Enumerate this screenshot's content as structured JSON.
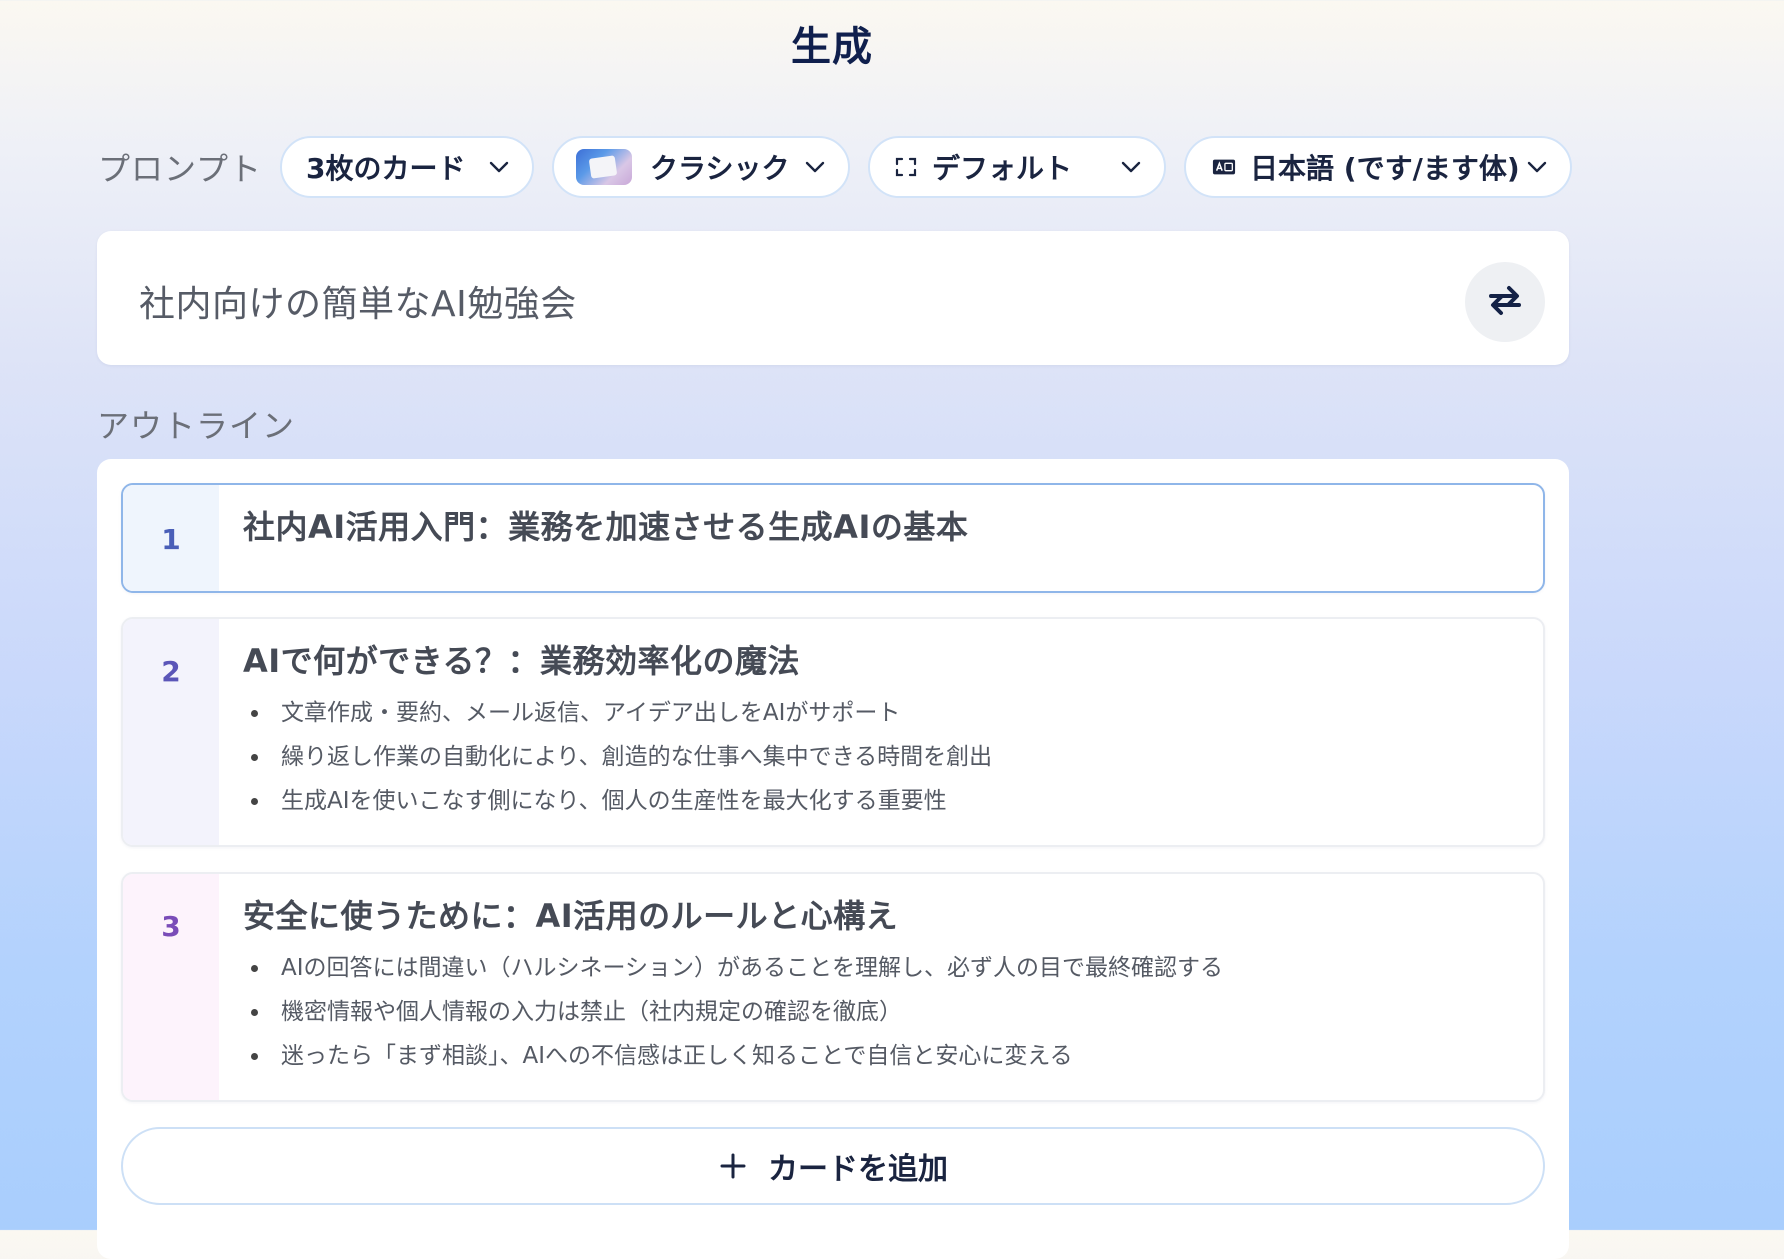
{
  "header": {
    "title": "生成"
  },
  "controls": {
    "label": "プロンプト",
    "card_count": {
      "value": "3枚のカード",
      "icon": "chevron-down-icon"
    },
    "theme": {
      "value": "クラシック",
      "thumbnail": "theme-thumbnail",
      "icon": "chevron-down-icon"
    },
    "format": {
      "value": "デフォルト",
      "icon": "frame-icon"
    },
    "language": {
      "value": "日本語 (です/ます体)",
      "icon": "translate-icon"
    }
  },
  "prompt": {
    "text": "社内向けの簡単なAI勉強会",
    "refresh_icon": "refresh-icon"
  },
  "outline": {
    "label": "アウトライン",
    "cards": [
      {
        "number": "1",
        "title": "社内AI活用入門：業務を加速させる生成AIの基本",
        "bullets": []
      },
      {
        "number": "2",
        "title": "AIで何ができる？：業務効率化の魔法",
        "bullets": [
          "文章作成・要約、メール返信、アイデア出しをAIがサポート",
          "繰り返し作業の自動化により、創造的な仕事へ集中できる時間を創出",
          "生成AIを使いこなす側になり、個人の生産性を最大化する重要性"
        ]
      },
      {
        "number": "3",
        "title": "安全に使うために：AI活用のルールと心構え",
        "bullets": [
          "AIの回答には間違い（ハルシネーション）があることを理解し、必ず人の目で最終確認する",
          "機密情報や個人情報の入力は禁止（社内規定の確認を徹底）",
          "迷ったら「まず相談」、AIへの不信感は正しく知ることで自信と安心に変える"
        ]
      }
    ],
    "add_card_label": "カードを追加"
  },
  "colors": {
    "accent_navy": "#0f1f4d",
    "active_border": "#8fb6e9",
    "pill_border": "#d2e3f8"
  }
}
